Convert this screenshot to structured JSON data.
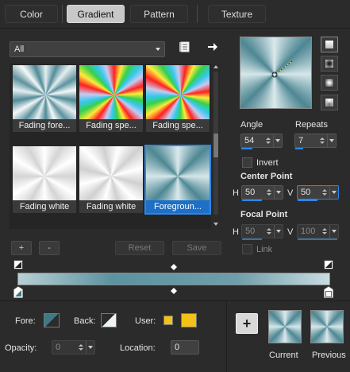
{
  "tabs": [
    {
      "label": "Color"
    },
    {
      "label": "Gradient"
    },
    {
      "label": "Pattern"
    },
    {
      "label": "Texture"
    }
  ],
  "library": {
    "category": "All",
    "thumbnails": [
      {
        "label": "Fading fore..."
      },
      {
        "label": "Fading spe..."
      },
      {
        "label": "Fading spe..."
      },
      {
        "label": "Fading white"
      },
      {
        "label": "Fading white"
      },
      {
        "label": "Foregroun..."
      }
    ],
    "add_label": "+",
    "remove_label": "-",
    "reset_label": "Reset",
    "save_label": "Save"
  },
  "controls": {
    "angle_label": "Angle",
    "angle_value": "54",
    "repeats_label": "Repeats",
    "repeats_value": "7",
    "invert_label": "Invert",
    "center_point_label": "Center Point",
    "center_h_label": "H",
    "center_h_value": "50",
    "center_v_label": "V",
    "center_v_value": "50",
    "focal_point_label": "Focal Point",
    "focal_h_label": "H",
    "focal_h_value": "50",
    "focal_v_label": "V",
    "focal_v_value": "100",
    "link_label": "Link"
  },
  "bottom": {
    "fore_label": "Fore:",
    "back_label": "Back:",
    "user_label": "User:",
    "opacity_label": "Opacity:",
    "opacity_value": "0",
    "location_label": "Location:",
    "location_value": "0",
    "add_label": "+",
    "current_label": "Current",
    "previous_label": "Previous"
  },
  "colors": {
    "accent": "#2f86e6",
    "user_swatch": "#f2c21b",
    "gradient_light": "#c9dde0",
    "gradient_dark": "#5b93a0"
  }
}
